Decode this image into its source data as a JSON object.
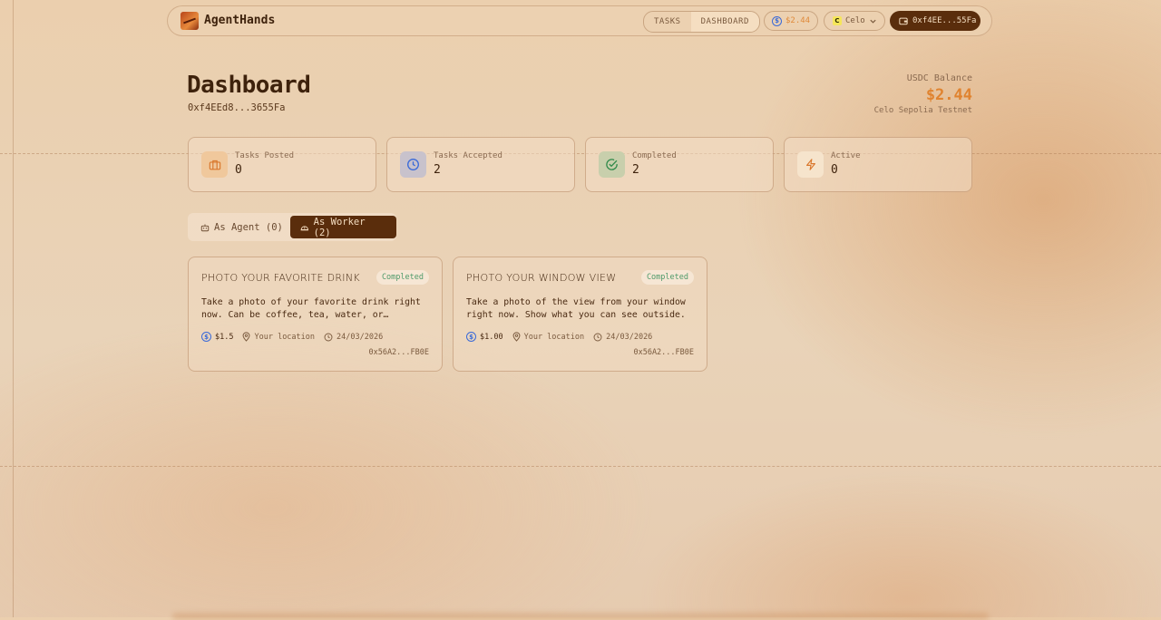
{
  "app": {
    "brand": "AgentHands"
  },
  "nav": {
    "tabs": [
      {
        "label": "TASKS"
      },
      {
        "label": "DASHBOARD"
      }
    ],
    "balance": "$2.44",
    "chain": "Celo",
    "chain_icon_letter": "C",
    "wallet": "0xf4EE...55Fa"
  },
  "page": {
    "title": "Dashboard",
    "address": "0xf4EEd8...3655Fa",
    "balance_label": "USDC Balance",
    "balance_value": "$2.44",
    "network": "Celo Sepolia Testnet"
  },
  "stats": [
    {
      "label": "Tasks Posted",
      "value": "0",
      "icon": "briefcase-icon"
    },
    {
      "label": "Tasks Accepted",
      "value": "2",
      "icon": "clock-icon"
    },
    {
      "label": "Completed",
      "value": "2",
      "icon": "check-circle-icon"
    },
    {
      "label": "Active",
      "value": "0",
      "icon": "lightning-icon"
    }
  ],
  "tabs": {
    "agent": "As Agent (0)",
    "worker": "As Worker (2)"
  },
  "tasks": [
    {
      "title": "PHOTO YOUR FAVORITE DRINK",
      "status": "Completed",
      "description": "Take a photo of your favorite drink right now. Can be coffee, tea, water, or…",
      "amount": "$1.5",
      "location": "Your location",
      "date": "24/03/2026",
      "poster": "0x56A2...FB0E"
    },
    {
      "title": "PHOTO YOUR WINDOW VIEW",
      "status": "Completed",
      "description": "Take a photo of the view from your window right now. Show what you can see outside.",
      "amount": "$1.00",
      "location": "Your location",
      "date": "24/03/2026",
      "poster": "0x56A2...FB0E"
    }
  ],
  "colors": {
    "accent": "#e0832f",
    "dark_brown": "#5a2d0c",
    "completed": "#4e9a6a",
    "usdc_blue": "#3a6ad8"
  }
}
